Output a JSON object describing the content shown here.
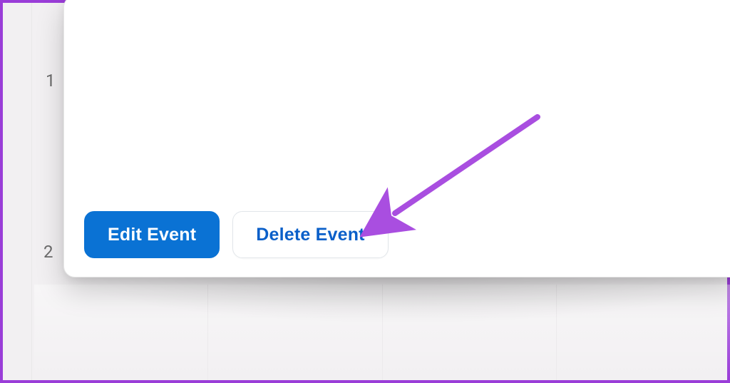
{
  "background": {
    "row_label_1": "1",
    "row_label_2": "2"
  },
  "modal": {
    "footer": {
      "edit_label": "Edit Event",
      "delete_label": "Delete Event"
    }
  },
  "annotation": {
    "arrow_color": "#a94ee0"
  }
}
